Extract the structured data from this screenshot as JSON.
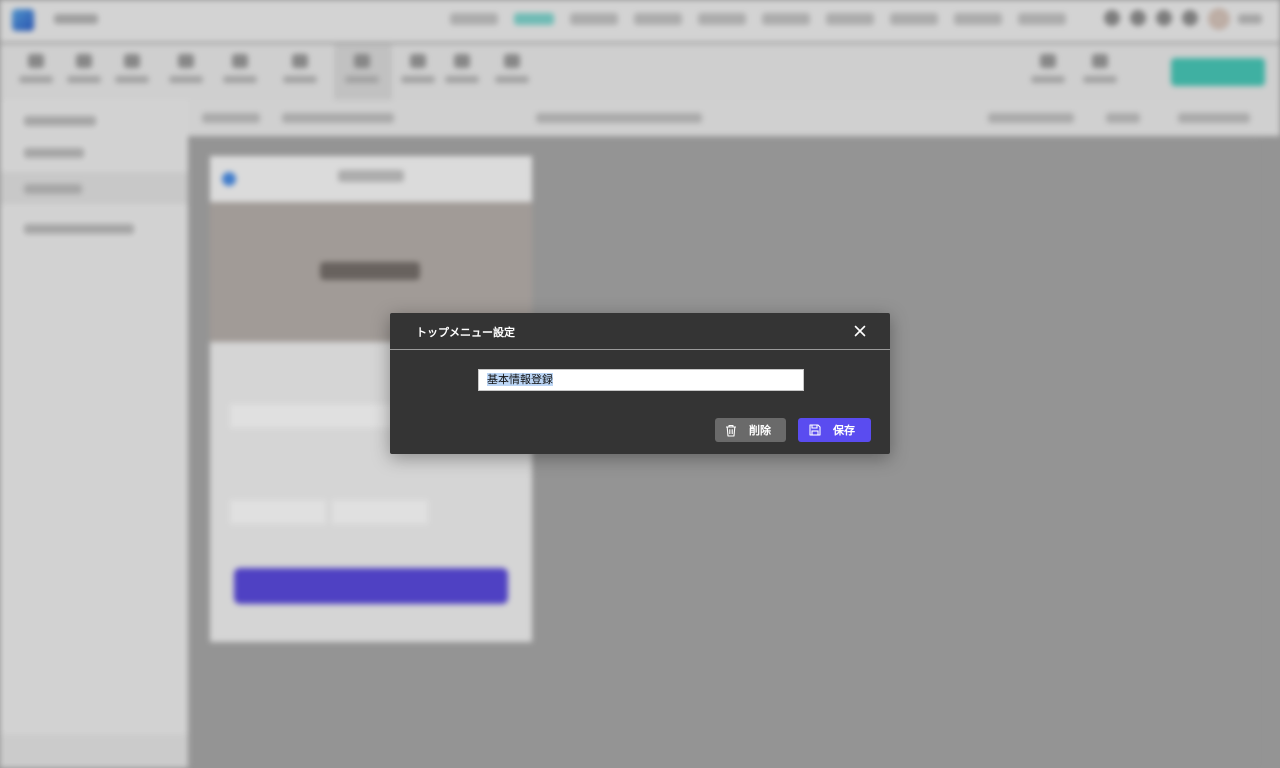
{
  "modal": {
    "title": "トップメニュー設定",
    "input_value": "基本情報登録",
    "delete_label": "削除",
    "save_label": "保存"
  },
  "colors": {
    "modal_bg": "#343434",
    "save_button": "#5a4cf0",
    "delete_button": "#6a6a6a",
    "accent_teal": "#48c9b9"
  },
  "icons": {
    "close": "close-icon",
    "delete": "trash-icon",
    "save": "save-icon"
  }
}
